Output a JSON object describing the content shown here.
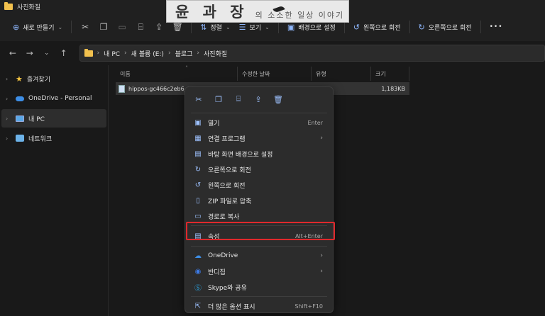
{
  "window": {
    "title": "사진화질"
  },
  "watermark": {
    "main": "윤 과 장",
    "sub": "의 소소한 일상 이야기"
  },
  "commandbar": {
    "new_label": "새로 만들기",
    "sort_label": "정렬",
    "view_label": "보기",
    "set_bg_label": "배경으로 설정",
    "rotate_left_label": "왼쪽으로 회전",
    "rotate_right_label": "오른쪽으로 회전",
    "more_label": "•••"
  },
  "address": {
    "crumbs": [
      "내 PC",
      "새 볼륨 (E:)",
      "블로그",
      "사진화질"
    ]
  },
  "sidebar": {
    "items": [
      {
        "label": "즐겨찾기"
      },
      {
        "label": "OneDrive - Personal"
      },
      {
        "label": "내 PC"
      },
      {
        "label": "네트워크"
      }
    ]
  },
  "columns": {
    "name": "이름",
    "modified": "수정한 날짜",
    "type": "유형",
    "size": "크기"
  },
  "file": {
    "name": "hippos-gc466c2eb6_1920",
    "size": "1,183KB"
  },
  "context_menu": {
    "items": [
      {
        "label": "열기",
        "shortcut": "Enter"
      },
      {
        "label": "연결 프로그램"
      },
      {
        "label": "바탕 화면 배경으로 설정"
      },
      {
        "label": "오른쪽으로 회전"
      },
      {
        "label": "왼쪽으로 회전"
      },
      {
        "label": "ZIP 파일로 압축"
      },
      {
        "label": "경로로 복사"
      },
      {
        "label": "속성",
        "shortcut": "Alt+Enter"
      },
      {
        "label": "OneDrive"
      },
      {
        "label": "반디집"
      },
      {
        "label": "Skype와 공유"
      },
      {
        "label": "더 많은 옵션 표시",
        "shortcut": "Shift+F10"
      }
    ]
  },
  "colors": {
    "highlight": "#e0282c",
    "accent": "#8fb8ff"
  }
}
